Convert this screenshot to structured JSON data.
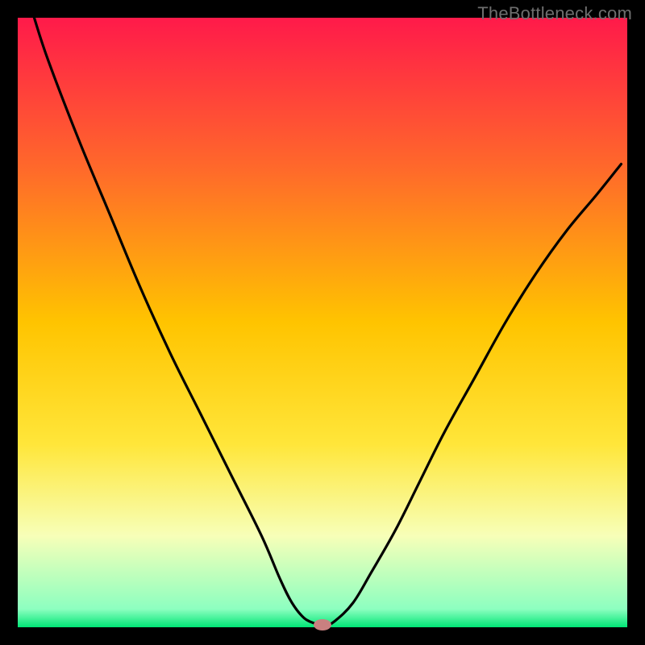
{
  "watermark": "TheBottleneck.com",
  "chart_data": {
    "type": "line",
    "title": "",
    "xlabel": "",
    "ylabel": "",
    "xlim": [
      0,
      100
    ],
    "ylim": [
      0,
      100
    ],
    "x": [
      2.7,
      5,
      10,
      15,
      20,
      25,
      30,
      35,
      40,
      43,
      45,
      47,
      49,
      50,
      52,
      55,
      58,
      62,
      66,
      70,
      75,
      80,
      85,
      90,
      95,
      99
    ],
    "values": [
      100,
      93,
      80,
      68,
      56,
      45,
      35,
      25,
      15,
      8,
      4,
      1.5,
      0.5,
      0,
      1,
      4,
      9,
      16,
      24,
      32,
      41,
      50,
      58,
      65,
      71,
      76
    ],
    "min_marker": {
      "x": 50,
      "y": 0
    },
    "background_gradient": {
      "stops": [
        {
          "offset": 0.0,
          "color": "#ff1a4a"
        },
        {
          "offset": 0.25,
          "color": "#ff6a2a"
        },
        {
          "offset": 0.5,
          "color": "#ffc400"
        },
        {
          "offset": 0.7,
          "color": "#ffe63a"
        },
        {
          "offset": 0.85,
          "color": "#f7ffb8"
        },
        {
          "offset": 0.97,
          "color": "#8dffc0"
        },
        {
          "offset": 1.0,
          "color": "#00e676"
        }
      ]
    },
    "marker_color": "#c98080",
    "curve_color": "#000000",
    "frame_color": "#000000"
  }
}
